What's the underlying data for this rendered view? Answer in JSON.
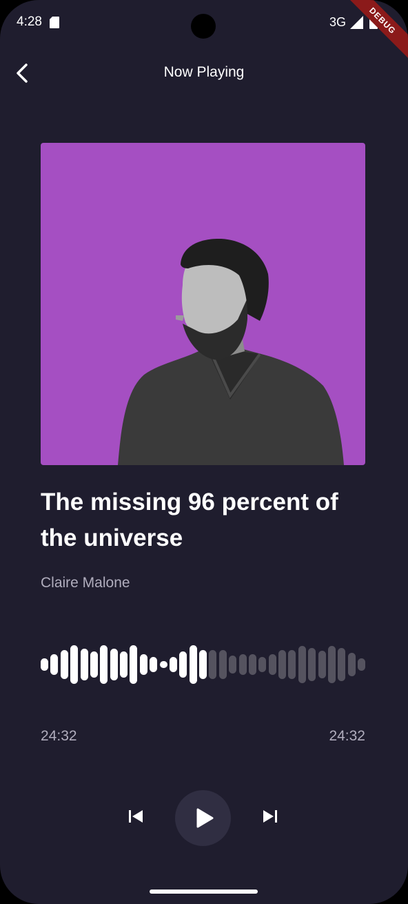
{
  "status_bar": {
    "time": "4:28",
    "network": "3G",
    "debug_label": "DEBUG"
  },
  "header": {
    "title": "Now Playing",
    "back_icon": "chevron-left-icon"
  },
  "track": {
    "title": "The missing 96 percent of the universe",
    "artist": "Claire Malone",
    "cover_color": "#a54fc2"
  },
  "player": {
    "current_time": "24:32",
    "total_time": "24:32",
    "progress_fraction": 0.52,
    "waveform_played_color": "#ffffff",
    "waveform_unplayed_color": "#55535f",
    "controls": [
      "skip-previous-icon",
      "play-icon",
      "skip-next-icon"
    ]
  }
}
